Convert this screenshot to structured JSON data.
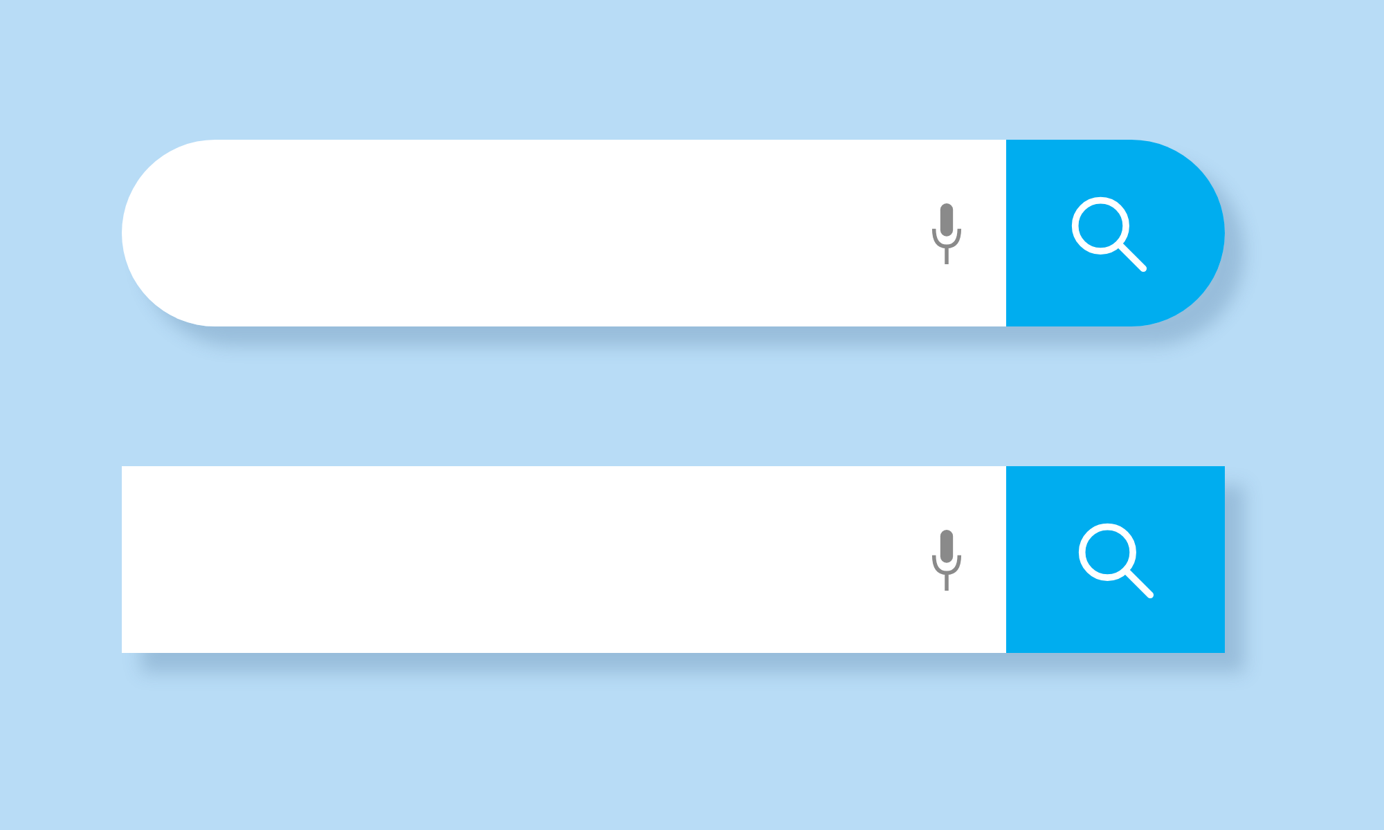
{
  "search_bars": [
    {
      "kind": "rounded"
    },
    {
      "kind": "square"
    }
  ]
}
